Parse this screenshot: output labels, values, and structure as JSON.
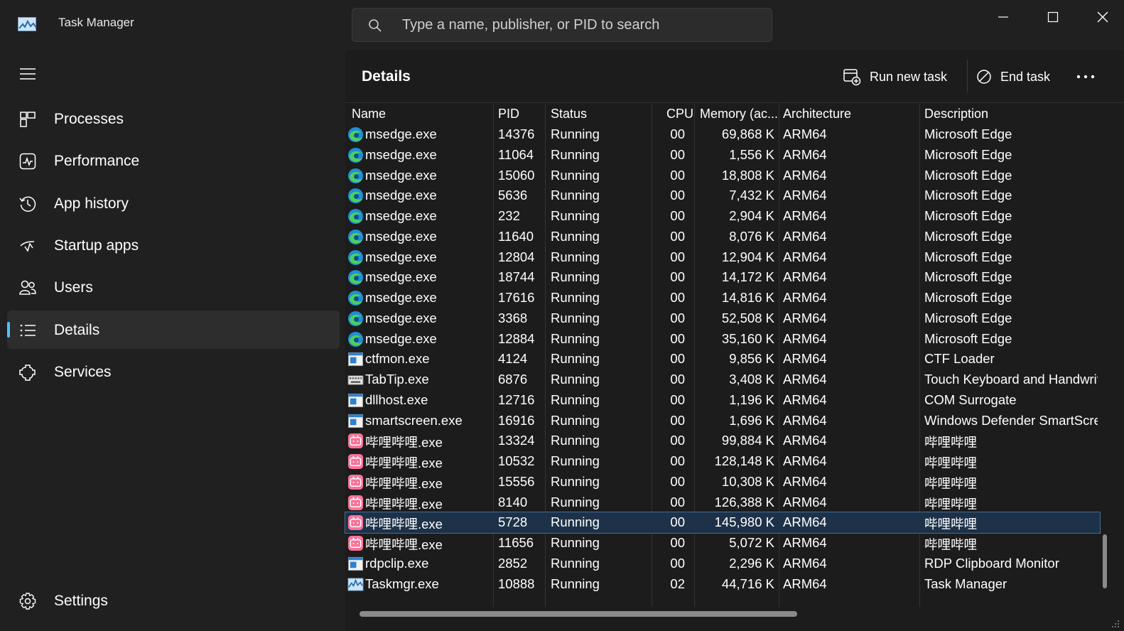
{
  "window": {
    "title": "Task Manager",
    "search_placeholder": "Type a name, publisher, or PID to search"
  },
  "sidebar": {
    "items": [
      {
        "label": "Processes",
        "icon": "processes-icon"
      },
      {
        "label": "Performance",
        "icon": "performance-icon"
      },
      {
        "label": "App history",
        "icon": "history-icon"
      },
      {
        "label": "Startup apps",
        "icon": "startup-icon"
      },
      {
        "label": "Users",
        "icon": "users-icon"
      },
      {
        "label": "Details",
        "icon": "list-icon",
        "active": true
      },
      {
        "label": "Services",
        "icon": "services-icon"
      }
    ],
    "settings_label": "Settings"
  },
  "main": {
    "title": "Details",
    "run_new_task_label": "Run new task",
    "end_task_label": "End task"
  },
  "table": {
    "columns": [
      "Name",
      "PID",
      "Status",
      "CPU",
      "Memory (ac...",
      "Architecture",
      "Description"
    ],
    "rows": [
      {
        "icon": "edge",
        "name": "msedge.exe",
        "pid": "14376",
        "status": "Running",
        "cpu": "00",
        "memory": "69,868 K",
        "arch": "ARM64",
        "desc": "Microsoft Edge"
      },
      {
        "icon": "edge",
        "name": "msedge.exe",
        "pid": "11064",
        "status": "Running",
        "cpu": "00",
        "memory": "1,556 K",
        "arch": "ARM64",
        "desc": "Microsoft Edge"
      },
      {
        "icon": "edge",
        "name": "msedge.exe",
        "pid": "15060",
        "status": "Running",
        "cpu": "00",
        "memory": "18,808 K",
        "arch": "ARM64",
        "desc": "Microsoft Edge"
      },
      {
        "icon": "edge",
        "name": "msedge.exe",
        "pid": "5636",
        "status": "Running",
        "cpu": "00",
        "memory": "7,432 K",
        "arch": "ARM64",
        "desc": "Microsoft Edge"
      },
      {
        "icon": "edge",
        "name": "msedge.exe",
        "pid": "232",
        "status": "Running",
        "cpu": "00",
        "memory": "2,904 K",
        "arch": "ARM64",
        "desc": "Microsoft Edge"
      },
      {
        "icon": "edge",
        "name": "msedge.exe",
        "pid": "11640",
        "status": "Running",
        "cpu": "00",
        "memory": "8,076 K",
        "arch": "ARM64",
        "desc": "Microsoft Edge"
      },
      {
        "icon": "edge",
        "name": "msedge.exe",
        "pid": "12804",
        "status": "Running",
        "cpu": "00",
        "memory": "12,904 K",
        "arch": "ARM64",
        "desc": "Microsoft Edge"
      },
      {
        "icon": "edge",
        "name": "msedge.exe",
        "pid": "18744",
        "status": "Running",
        "cpu": "00",
        "memory": "14,172 K",
        "arch": "ARM64",
        "desc": "Microsoft Edge"
      },
      {
        "icon": "edge",
        "name": "msedge.exe",
        "pid": "17616",
        "status": "Running",
        "cpu": "00",
        "memory": "14,816 K",
        "arch": "ARM64",
        "desc": "Microsoft Edge"
      },
      {
        "icon": "edge",
        "name": "msedge.exe",
        "pid": "3368",
        "status": "Running",
        "cpu": "00",
        "memory": "52,508 K",
        "arch": "ARM64",
        "desc": "Microsoft Edge"
      },
      {
        "icon": "edge",
        "name": "msedge.exe",
        "pid": "12884",
        "status": "Running",
        "cpu": "00",
        "memory": "35,160 K",
        "arch": "ARM64",
        "desc": "Microsoft Edge"
      },
      {
        "icon": "window",
        "name": "ctfmon.exe",
        "pid": "4124",
        "status": "Running",
        "cpu": "00",
        "memory": "9,856 K",
        "arch": "ARM64",
        "desc": "CTF Loader"
      },
      {
        "icon": "keyboard",
        "name": "TabTip.exe",
        "pid": "6876",
        "status": "Running",
        "cpu": "00",
        "memory": "3,408 K",
        "arch": "ARM64",
        "desc": "Touch Keyboard and Handwriti"
      },
      {
        "icon": "window",
        "name": "dllhost.exe",
        "pid": "12716",
        "status": "Running",
        "cpu": "00",
        "memory": "1,196 K",
        "arch": "ARM64",
        "desc": "COM Surrogate"
      },
      {
        "icon": "window",
        "name": "smartscreen.exe",
        "pid": "16916",
        "status": "Running",
        "cpu": "00",
        "memory": "1,696 K",
        "arch": "ARM64",
        "desc": "Windows Defender SmartScree"
      },
      {
        "icon": "bili",
        "name": "哔哩哔哩.exe",
        "pid": "13324",
        "status": "Running",
        "cpu": "00",
        "memory": "99,884 K",
        "arch": "ARM64",
        "desc": "哔哩哔哩"
      },
      {
        "icon": "bili",
        "name": "哔哩哔哩.exe",
        "pid": "10532",
        "status": "Running",
        "cpu": "00",
        "memory": "128,148 K",
        "arch": "ARM64",
        "desc": "哔哩哔哩"
      },
      {
        "icon": "bili",
        "name": "哔哩哔哩.exe",
        "pid": "15556",
        "status": "Running",
        "cpu": "00",
        "memory": "10,308 K",
        "arch": "ARM64",
        "desc": "哔哩哔哩"
      },
      {
        "icon": "bili",
        "name": "哔哩哔哩.exe",
        "pid": "8140",
        "status": "Running",
        "cpu": "00",
        "memory": "126,388 K",
        "arch": "ARM64",
        "desc": "哔哩哔哩"
      },
      {
        "icon": "bili",
        "name": "哔哩哔哩.exe",
        "pid": "5728",
        "status": "Running",
        "cpu": "00",
        "memory": "145,980 K",
        "arch": "ARM64",
        "desc": "哔哩哔哩",
        "selected": true
      },
      {
        "icon": "bili",
        "name": "哔哩哔哩.exe",
        "pid": "11656",
        "status": "Running",
        "cpu": "00",
        "memory": "5,072 K",
        "arch": "ARM64",
        "desc": "哔哩哔哩"
      },
      {
        "icon": "window",
        "name": "rdpclip.exe",
        "pid": "2852",
        "status": "Running",
        "cpu": "00",
        "memory": "2,296 K",
        "arch": "ARM64",
        "desc": "RDP Clipboard Monitor"
      },
      {
        "icon": "taskmgr",
        "name": "Taskmgr.exe",
        "pid": "10888",
        "status": "Running",
        "cpu": "02",
        "memory": "44,716 K",
        "arch": "ARM64",
        "desc": "Task Manager"
      }
    ]
  },
  "colors": {
    "accent": "#4cc2ff",
    "selected_row": "#1d3249",
    "background": "#202020",
    "panel": "#1c1c1c",
    "edge_blue": "#1e8fd6",
    "edge_green": "#4fcf5c",
    "bili_pink": "#fb7299"
  }
}
